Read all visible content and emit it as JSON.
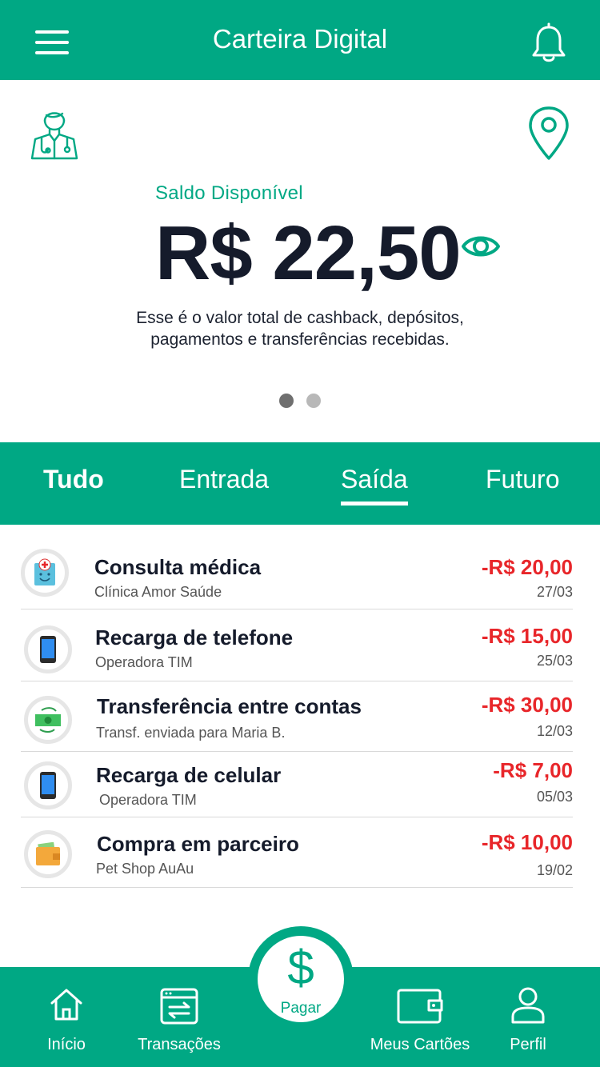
{
  "header": {
    "title": "Carteira Digital",
    "menu_icon": "hamburger-menu-icon",
    "bell_icon": "bell-icon"
  },
  "balance": {
    "label": "Saldo Disponível",
    "value": "R$ 22,50",
    "description_line1": "Esse é o valor total de cashback, depósitos,",
    "description_line2": "pagamentos e transferências recebidas."
  },
  "carousel": {
    "pages": 2,
    "active": 0
  },
  "tabs": [
    {
      "label": "Tudo"
    },
    {
      "label": "Entrada"
    },
    {
      "label": "Saída"
    },
    {
      "label": "Futuro"
    }
  ],
  "active_tab": "Saída",
  "transactions": [
    {
      "title": "Consulta médica",
      "subtitle": "Clínica Amor Saúde",
      "amount": "-R$ 20,00",
      "date": "27/03",
      "icon": "medical-icon"
    },
    {
      "title": "Recarga de telefone",
      "subtitle": "Operadora TIM",
      "amount": "-R$ 15,00",
      "date": "25/03",
      "icon": "phone-icon"
    },
    {
      "title": "Transferência entre contas",
      "subtitle": "Transf. enviada para Maria B.",
      "amount": "-R$ 30,00",
      "date": "12/03",
      "icon": "money-transfer-icon"
    },
    {
      "title": "Recarga de celular",
      "subtitle": "Operadora TIM",
      "amount": "-R$ 7,00",
      "date": "05/03",
      "icon": "phone-icon"
    },
    {
      "title": "Compra em parceiro",
      "subtitle": "Pet Shop AuAu",
      "amount": "-R$ 10,00",
      "date": "19/02",
      "icon": "wallet-icon"
    }
  ],
  "bottom_nav": {
    "home": "Início",
    "transactions": "Transações",
    "pay": "Pagar",
    "pay_symbol": "$",
    "cards": "Meus Cartões",
    "profile": "Perfil"
  },
  "colors": {
    "brand": "#00a884",
    "negative": "#e8262a",
    "text": "#151b2b"
  }
}
